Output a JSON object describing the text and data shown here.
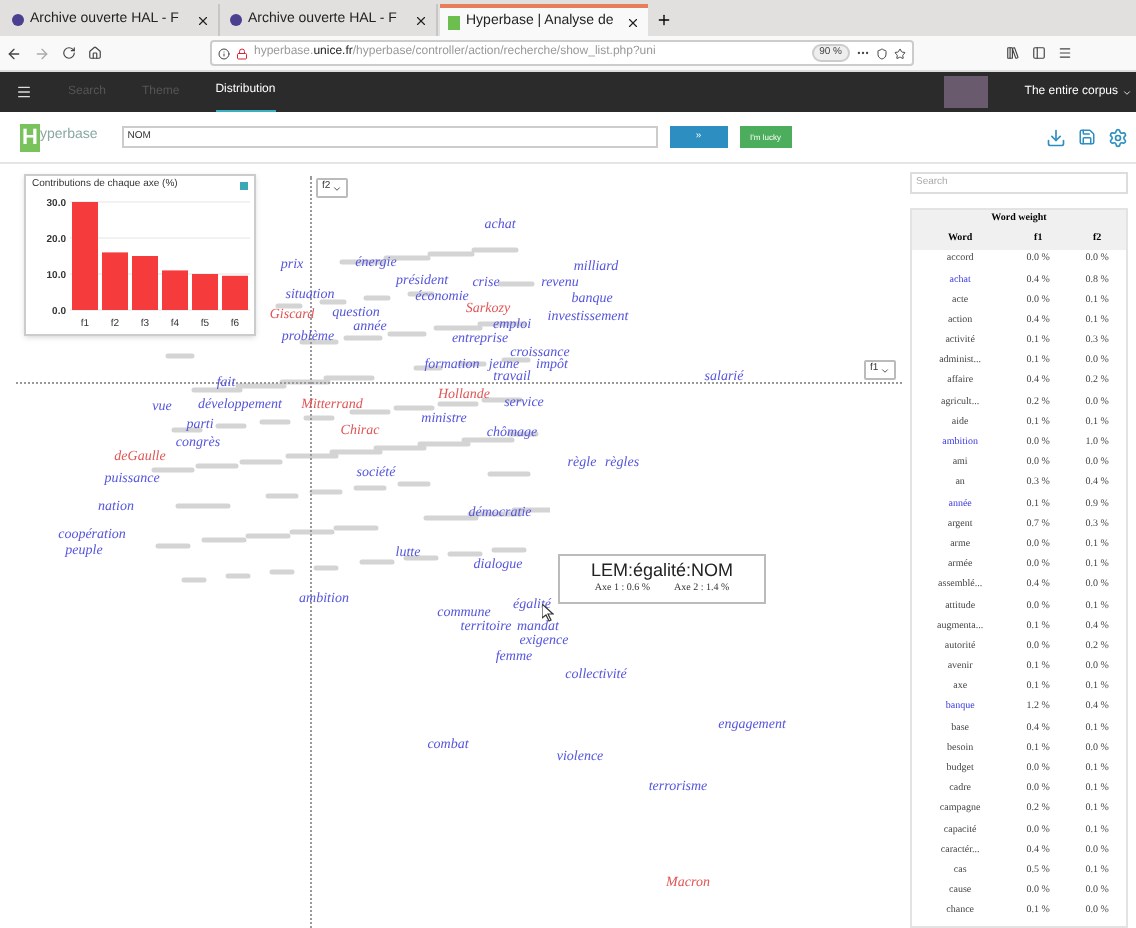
{
  "browser": {
    "tabs": [
      {
        "label": "Archive ouverte HAL - F",
        "selected": false,
        "kind": "hal"
      },
      {
        "label": "Archive ouverte HAL - F",
        "selected": false,
        "kind": "hal"
      },
      {
        "label": "Hyperbase | Analyse de",
        "selected": true,
        "kind": "hyperbase"
      }
    ],
    "url": {
      "host_prefix": "hyperbase.",
      "host": "unice.fr",
      "path": "/hyperbase/controller/action/recherche/show_list.php?uni"
    },
    "zoom": "90 %"
  },
  "app_nav": {
    "items": [
      {
        "label": "Search",
        "selected": false
      },
      {
        "label": "Theme",
        "selected": false
      },
      {
        "label": "Distribution",
        "selected": true
      }
    ],
    "corpus": "The entire corpus"
  },
  "search": {
    "logo_letter": "H",
    "logo_text": "yperbase",
    "value": "NOM",
    "go_button": "»",
    "lucky_button": "I'm lucky"
  },
  "contributions": {
    "chart_data": {
      "type": "bar",
      "title": "Contributions de chaque axe (%)",
      "categories": [
        "f1",
        "f2",
        "f3",
        "f4",
        "f5",
        "f6"
      ],
      "values": [
        30,
        16,
        15,
        11,
        10,
        9.5
      ],
      "ylim": [
        0,
        30
      ],
      "yticks": [
        {
          "value": 0,
          "label": "0.0"
        },
        {
          "value": 10,
          "label": "10.0"
        },
        {
          "value": 20,
          "label": "20.0"
        },
        {
          "value": 30,
          "label": "30.0"
        }
      ]
    }
  },
  "plot": {
    "y_axis_select": "f2",
    "x_axis_select": "f1",
    "words": [
      {
        "text": "achat",
        "color": "#5555dd"
      },
      {
        "text": "prix",
        "color": "#5555dd"
      },
      {
        "text": "énergie",
        "color": "#5555dd"
      },
      {
        "text": "président",
        "color": "#5555dd"
      },
      {
        "text": "crise",
        "color": "#5555dd"
      },
      {
        "text": "économie",
        "color": "#5555dd"
      },
      {
        "text": "milliard",
        "color": "#5555dd"
      },
      {
        "text": "revenu",
        "color": "#5555dd"
      },
      {
        "text": "banque",
        "color": "#5555dd"
      },
      {
        "text": "investissement",
        "color": "#5555dd"
      },
      {
        "text": "situation",
        "color": "#5555dd"
      },
      {
        "text": "Giscard",
        "color": "#e05555"
      },
      {
        "text": "question",
        "color": "#5555dd"
      },
      {
        "text": "année",
        "color": "#5555dd"
      },
      {
        "text": "problème",
        "color": "#5555dd"
      },
      {
        "text": "Sarkozy",
        "color": "#e05555"
      },
      {
        "text": "emploi",
        "color": "#5555dd"
      },
      {
        "text": "entreprise",
        "color": "#5555dd"
      },
      {
        "text": "croissance",
        "color": "#5555dd"
      },
      {
        "text": "formation",
        "color": "#5555dd"
      },
      {
        "text": "jeune",
        "color": "#5555dd"
      },
      {
        "text": "impôt",
        "color": "#5555dd"
      },
      {
        "text": "travail",
        "color": "#5555dd"
      },
      {
        "text": "Hollande",
        "color": "#e05555"
      },
      {
        "text": "service",
        "color": "#5555dd"
      },
      {
        "text": "salarié",
        "color": "#5555dd"
      },
      {
        "text": "fait",
        "color": "#5555dd"
      },
      {
        "text": "vue",
        "color": "#5555dd"
      },
      {
        "text": "développement",
        "color": "#5555dd"
      },
      {
        "text": "parti",
        "color": "#5555dd"
      },
      {
        "text": "Mitterrand",
        "color": "#e05555"
      },
      {
        "text": "ministre",
        "color": "#5555dd"
      },
      {
        "text": "Chirac",
        "color": "#e05555"
      },
      {
        "text": "chômage",
        "color": "#5555dd"
      },
      {
        "text": "règle",
        "color": "#5555dd"
      },
      {
        "text": "règles",
        "color": "#5555dd"
      },
      {
        "text": "congrès",
        "color": "#5555dd"
      },
      {
        "text": "deGaulle",
        "color": "#e05555"
      },
      {
        "text": "société",
        "color": "#5555dd"
      },
      {
        "text": "puissance",
        "color": "#5555dd"
      },
      {
        "text": "nation",
        "color": "#5555dd"
      },
      {
        "text": "démocratie",
        "color": "#5555dd"
      },
      {
        "text": "coopération",
        "color": "#5555dd"
      },
      {
        "text": "peuple",
        "color": "#5555dd"
      },
      {
        "text": "lutte",
        "color": "#5555dd"
      },
      {
        "text": "dialogue",
        "color": "#5555dd"
      },
      {
        "text": "ambition",
        "color": "#5555dd"
      },
      {
        "text": "commune",
        "color": "#5555dd"
      },
      {
        "text": "égalité",
        "color": "#5555dd"
      },
      {
        "text": "territoire",
        "color": "#5555dd"
      },
      {
        "text": "mandat",
        "color": "#5555dd"
      },
      {
        "text": "exigence",
        "color": "#5555dd"
      },
      {
        "text": "femme",
        "color": "#5555dd"
      },
      {
        "text": "collectivité",
        "color": "#5555dd"
      },
      {
        "text": "engagement",
        "color": "#5555dd"
      },
      {
        "text": "combat",
        "color": "#5555dd"
      },
      {
        "text": "violence",
        "color": "#5555dd"
      },
      {
        "text": "terrorisme",
        "color": "#5555dd"
      },
      {
        "text": "Macron",
        "color": "#e05555"
      }
    ],
    "tooltip": {
      "title": "LEM:égalité:NOM",
      "axis_1": "Axe 1 : 0.6 %",
      "axis_2": "Axe 2 : 1.4 %"
    }
  },
  "word_weight": {
    "search_placeholder": "Search",
    "title": "Word weight",
    "columns": [
      "Word",
      "f1",
      "f2"
    ],
    "rows": [
      {
        "word": "accord",
        "f1": "0.0 %",
        "f2": "0.0 %",
        "highlighted": false
      },
      {
        "word": "achat",
        "f1": "0.4 %",
        "f2": "0.8 %",
        "highlighted": true
      },
      {
        "word": "acte",
        "f1": "0.0 %",
        "f2": "0.1 %",
        "highlighted": false
      },
      {
        "word": "action",
        "f1": "0.4 %",
        "f2": "0.1 %",
        "highlighted": false
      },
      {
        "word": "activité",
        "f1": "0.1 %",
        "f2": "0.3 %",
        "highlighted": false
      },
      {
        "word": "administ...",
        "f1": "0.1 %",
        "f2": "0.0 %",
        "highlighted": false
      },
      {
        "word": "affaire",
        "f1": "0.4 %",
        "f2": "0.2 %",
        "highlighted": false
      },
      {
        "word": "agricult...",
        "f1": "0.2 %",
        "f2": "0.0 %",
        "highlighted": false
      },
      {
        "word": "aide",
        "f1": "0.1 %",
        "f2": "0.1 %",
        "highlighted": false
      },
      {
        "word": "ambition",
        "f1": "0.0 %",
        "f2": "1.0 %",
        "highlighted": true
      },
      {
        "word": "ami",
        "f1": "0.0 %",
        "f2": "0.0 %",
        "highlighted": false
      },
      {
        "word": "an",
        "f1": "0.3 %",
        "f2": "0.4 %",
        "highlighted": false
      },
      {
        "word": "année",
        "f1": "0.1 %",
        "f2": "0.9 %",
        "highlighted": true
      },
      {
        "word": "argent",
        "f1": "0.7 %",
        "f2": "0.3 %",
        "highlighted": false
      },
      {
        "word": "arme",
        "f1": "0.0 %",
        "f2": "0.1 %",
        "highlighted": false
      },
      {
        "word": "armée",
        "f1": "0.0 %",
        "f2": "0.1 %",
        "highlighted": false
      },
      {
        "word": "assemblé...",
        "f1": "0.4 %",
        "f2": "0.0 %",
        "highlighted": false
      },
      {
        "word": "attitude",
        "f1": "0.0 %",
        "f2": "0.1 %",
        "highlighted": false
      },
      {
        "word": "augmenta...",
        "f1": "0.1 %",
        "f2": "0.4 %",
        "highlighted": false
      },
      {
        "word": "autorité",
        "f1": "0.0 %",
        "f2": "0.2 %",
        "highlighted": false
      },
      {
        "word": "avenir",
        "f1": "0.1 %",
        "f2": "0.0 %",
        "highlighted": false
      },
      {
        "word": "axe",
        "f1": "0.1 %",
        "f2": "0.1 %",
        "highlighted": false
      },
      {
        "word": "banque",
        "f1": "1.2 %",
        "f2": "0.4 %",
        "highlighted": true
      },
      {
        "word": "base",
        "f1": "0.4 %",
        "f2": "0.1 %",
        "highlighted": false
      },
      {
        "word": "besoin",
        "f1": "0.1 %",
        "f2": "0.0 %",
        "highlighted": false
      },
      {
        "word": "budget",
        "f1": "0.0 %",
        "f2": "0.1 %",
        "highlighted": false
      },
      {
        "word": "cadre",
        "f1": "0.0 %",
        "f2": "0.1 %",
        "highlighted": false
      },
      {
        "word": "campagne",
        "f1": "0.2 %",
        "f2": "0.1 %",
        "highlighted": false
      },
      {
        "word": "capacité",
        "f1": "0.0 %",
        "f2": "0.1 %",
        "highlighted": false
      },
      {
        "word": "caractér...",
        "f1": "0.4 %",
        "f2": "0.0 %",
        "highlighted": false
      },
      {
        "word": "cas",
        "f1": "0.5 %",
        "f2": "0.1 %",
        "highlighted": false
      },
      {
        "word": "cause",
        "f1": "0.0 %",
        "f2": "0.0 %",
        "highlighted": false
      },
      {
        "word": "chance",
        "f1": "0.1 %",
        "f2": "0.0 %",
        "highlighted": false
      }
    ]
  }
}
